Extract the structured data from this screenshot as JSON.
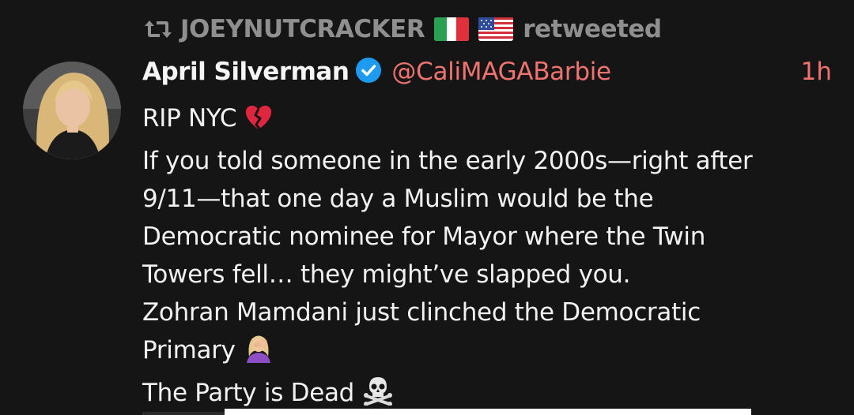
{
  "retweet": {
    "icon": "retweet-icon",
    "name": "JOEYNUTCRACKER",
    "flags": [
      "italy-flag-icon",
      "usa-flag-icon"
    ],
    "label": "retweeted"
  },
  "author": {
    "display_name": "April Silverman",
    "verified": true,
    "handle": "@CaliMAGABarbie",
    "time": "1h"
  },
  "tweet": {
    "lines": [
      "RIP NYC",
      "If you told someone in the early 2000s—right after",
      "9/11—that one day a Muslim would be the",
      "Democratic nominee for Mayor where the Twin",
      "Towers fell… they might’ve slapped you.",
      "Zohran Mamdani just clinched the Democratic",
      "Primary",
      "The Party is Dead"
    ],
    "emojis": {
      "line_0": "broken-heart-icon",
      "line_6": "facepalm-icon",
      "line_7": "skull-crossbones-icon"
    }
  },
  "colors": {
    "background": "#151515",
    "text": "#f2f2f2",
    "muted": "#8f8f8f",
    "accent": "#f0736f",
    "verified": "#1d9bf0"
  }
}
